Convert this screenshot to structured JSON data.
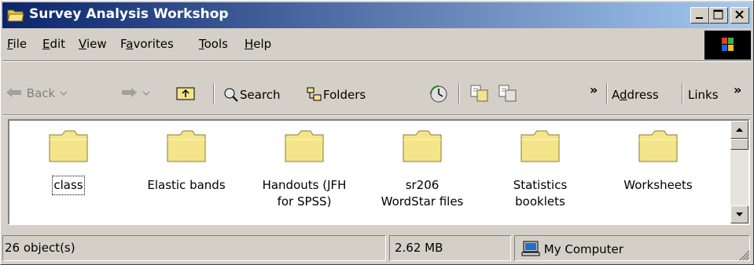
{
  "window": {
    "title": "Survey Analysis Workshop"
  },
  "menu": {
    "items": [
      {
        "first": "F",
        "rest": "ile"
      },
      {
        "first": "E",
        "rest": "dit"
      },
      {
        "first": "V",
        "rest": "iew"
      },
      {
        "pre": "F",
        "first": "a",
        "rest": "vorites"
      },
      {
        "first": "T",
        "rest": "ools"
      },
      {
        "first": "H",
        "rest": "elp"
      }
    ]
  },
  "toolbar": {
    "back_label": "Back",
    "search_label": "Search",
    "folders_label": "Folders",
    "chevron": "»",
    "address_pre": "A",
    "address_underlined": "d",
    "address_rest": "dress",
    "links_label": "Links"
  },
  "folders": [
    {
      "label": "class",
      "selected": true
    },
    {
      "label": "Elastic bands"
    },
    {
      "label": "Handouts (JFH for SPSS)",
      "line1": "Handouts (JFH",
      "line2": "for SPSS)"
    },
    {
      "label": "sr206 WordStar files",
      "line1": "sr206",
      "line2": "WordStar files"
    },
    {
      "label": "Statistics booklets",
      "line1": "Statistics",
      "line2": "booklets"
    },
    {
      "label": "Worksheets"
    }
  ],
  "status": {
    "objects": "26 object(s)",
    "size": "2.62 MB",
    "location": "My Computer"
  },
  "colors": {
    "titlebar_start": "#0a246a",
    "titlebar_end": "#a6caf0",
    "face": "#d4d0c8",
    "folder": "#f4e58a"
  }
}
